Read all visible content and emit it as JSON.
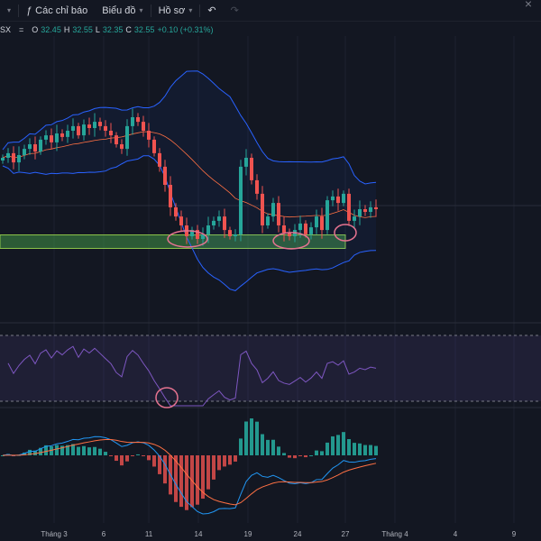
{
  "toolbar": {
    "indicators_label": "Các chỉ báo",
    "chart_label": "Biểu đồ",
    "profile_label": "Hồ sơ",
    "undo_icon": "undo-icon",
    "redo_icon": "redo-icon",
    "close_icon": "close-icon"
  },
  "legend": {
    "symbol": "SX",
    "eq": "=",
    "o_label": "O",
    "o": "32.45",
    "h_label": "H",
    "h": "32.55",
    "l_label": "L",
    "l": "32.35",
    "c_label": "C",
    "c": "32.55",
    "change": "+0.10 (+0.31%)"
  },
  "colors": {
    "up": "#26a69a",
    "down": "#ef5350",
    "bb": "#2962ff",
    "rsi": "#7e57c2",
    "zone": "#4caf50",
    "annot": "#e57390"
  },
  "x_axis": [
    "Tháng 3",
    "6",
    "11",
    "14",
    "19",
    "24",
    "27",
    "Tháng 4",
    "4",
    "9"
  ],
  "chart_data": {
    "type": "candlestick",
    "closes": [
      34.45,
      34.62,
      34.28,
      34.55,
      34.78,
      34.95,
      34.68,
      35.12,
      35.28,
      35.02,
      35.35,
      35.22,
      35.45,
      35.62,
      35.28,
      35.68,
      35.55,
      35.78,
      35.62,
      35.45,
      35.28,
      34.95,
      34.78,
      35.62,
      35.95,
      35.78,
      35.45,
      35.12,
      34.62,
      34.12,
      33.45,
      32.62,
      32.28,
      31.95,
      31.55,
      31.78,
      31.45,
      31.62,
      31.95,
      32.12,
      32.28,
      31.78,
      31.55,
      31.62,
      34.12,
      34.45,
      33.62,
      33.12,
      31.95,
      32.28,
      32.78,
      31.95,
      31.68,
      31.55,
      31.78,
      32.02,
      31.62,
      31.88,
      32.28,
      31.78,
      32.88,
      33.02,
      32.78,
      33.12,
      32.12,
      32.28,
      32.55,
      32.45,
      32.62,
      32.55
    ],
    "support_zone": [
      31.1,
      31.6
    ],
    "indicators": [
      "Bollinger Bands (20,2)",
      "RSI (14)",
      "MACD (12,26,9)"
    ]
  }
}
